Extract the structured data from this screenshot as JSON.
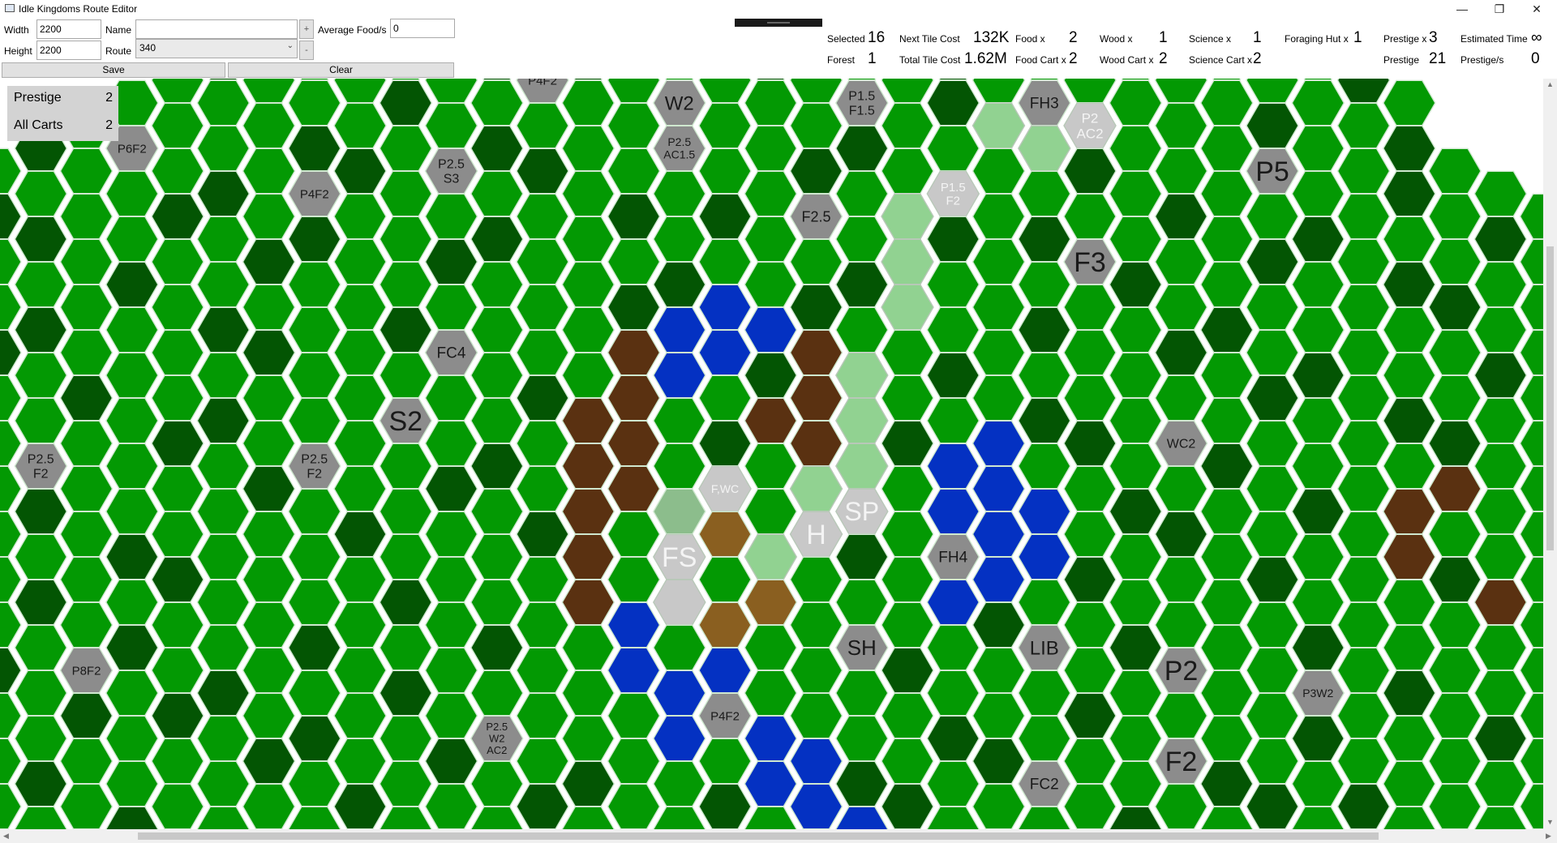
{
  "window": {
    "title": "Idle Kingdoms Route Editor",
    "minimize_glyph": "—",
    "maximize_glyph": "❐",
    "close_glyph": "✕"
  },
  "editor": {
    "width_label": "Width",
    "width_value": "2200",
    "height_label": "Height",
    "height_value": "2200",
    "name_label": "Name",
    "name_value": "",
    "route_label": "Route",
    "route_value": "340",
    "add_glyph": "+",
    "remove_glyph": "-",
    "avg_food_label": "Average Food/s",
    "avg_food_value": "0",
    "save_label": "Save",
    "clear_label": "Clear"
  },
  "stats": {
    "selected_label": "Selected",
    "selected_value": "16",
    "forest_label": "Forest",
    "forest_value": "1",
    "next_tile_cost_label": "Next Tile Cost",
    "next_tile_cost_value": "132K",
    "total_tile_cost_label": "Total Tile Cost",
    "total_tile_cost_value": "1.62M",
    "food_x_label": "Food x",
    "food_x_value": "2",
    "food_cart_x_label": "Food Cart x",
    "food_cart_x_value": "2",
    "wood_x_label": "Wood x",
    "wood_x_value": "1",
    "wood_cart_x_label": "Wood Cart x",
    "wood_cart_x_value": "2",
    "science_x_label": "Science x",
    "science_x_value": "1",
    "science_cart_x_label": "Science Cart x",
    "science_cart_x_value": "2",
    "foraging_hut_x_label": "Foraging Hut x",
    "foraging_hut_x_value": "1",
    "prestige_x_label": "Prestige x",
    "prestige_x_value": "3",
    "prestige_label": "Prestige",
    "prestige_value": "21",
    "estimated_time_label": "Estimated Time",
    "estimated_time_value": "∞",
    "prestige_per_s_label": "Prestige/s",
    "prestige_per_s_value": "0"
  },
  "legend": {
    "prestige_label": "Prestige",
    "prestige_value": "2",
    "all_carts_label": "All Carts",
    "all_carts_value": "2"
  },
  "scroll_arrows": {
    "up": "▲",
    "down": "▼",
    "left": "◀",
    "right": "▶"
  },
  "colors": {
    "grass": "#039903",
    "forest": "#035503",
    "water": "#0431c2",
    "mountain": "#5a3111",
    "dirt": "#8a5f20",
    "special": "#8c8c8c",
    "route": "#91d291",
    "route_special": "#c8c8c8",
    "route_forest": "#8cbd8c",
    "border": "#cfe8cf"
  },
  "map": {
    "forest_tiles": [
      [
        0,
        -1
      ],
      [
        2,
        -1
      ],
      [
        3,
        -1
      ],
      [
        5,
        -1
      ],
      [
        8,
        -1
      ],
      [
        11,
        -1
      ],
      [
        13,
        -1
      ],
      [
        17,
        -1
      ],
      [
        21,
        -1
      ],
      [
        24,
        -1
      ],
      [
        28,
        -1
      ],
      [
        30,
        -1
      ],
      [
        9,
        0
      ],
      [
        12,
        0
      ],
      [
        19,
        0
      ],
      [
        21,
        0
      ],
      [
        30,
        0
      ],
      [
        1,
        1
      ],
      [
        7,
        1
      ],
      [
        11,
        1
      ],
      [
        15,
        1
      ],
      [
        19,
        1
      ],
      [
        22,
        1
      ],
      [
        24,
        1
      ],
      [
        28,
        1
      ],
      [
        31,
        1
      ],
      [
        5,
        2
      ],
      [
        8,
        2
      ],
      [
        12,
        2
      ],
      [
        18,
        2
      ],
      [
        24,
        2
      ],
      [
        31,
        2
      ],
      [
        0,
        3
      ],
      [
        1,
        3
      ],
      [
        4,
        3
      ],
      [
        7,
        3
      ],
      [
        11,
        3
      ],
      [
        14,
        3
      ],
      [
        16,
        3
      ],
      [
        21,
        3
      ],
      [
        23,
        3
      ],
      [
        26,
        3
      ],
      [
        29,
        3
      ],
      [
        33,
        3
      ],
      [
        3,
        4
      ],
      [
        6,
        4
      ],
      [
        10,
        4
      ],
      [
        15,
        4
      ],
      [
        19,
        4
      ],
      [
        25,
        4
      ],
      [
        28,
        4
      ],
      [
        31,
        4
      ],
      [
        1,
        5
      ],
      [
        5,
        5
      ],
      [
        9,
        5
      ],
      [
        14,
        5
      ],
      [
        18,
        5
      ],
      [
        23,
        5
      ],
      [
        27,
        5
      ],
      [
        32,
        5
      ],
      [
        0,
        6
      ],
      [
        6,
        6
      ],
      [
        10,
        6
      ],
      [
        17,
        6
      ],
      [
        21,
        6
      ],
      [
        26,
        6
      ],
      [
        29,
        6
      ],
      [
        33,
        6
      ],
      [
        2,
        7
      ],
      [
        5,
        7
      ],
      [
        9,
        7
      ],
      [
        12,
        7
      ],
      [
        19,
        7
      ],
      [
        23,
        7
      ],
      [
        28,
        7
      ],
      [
        31,
        7
      ],
      [
        4,
        8
      ],
      [
        7,
        8
      ],
      [
        11,
        8
      ],
      [
        14,
        8
      ],
      [
        16,
        8
      ],
      [
        20,
        8
      ],
      [
        24,
        8
      ],
      [
        27,
        8
      ],
      [
        32,
        8
      ],
      [
        1,
        9
      ],
      [
        6,
        9
      ],
      [
        10,
        9
      ],
      [
        13,
        9
      ],
      [
        18,
        9
      ],
      [
        22,
        9
      ],
      [
        25,
        9
      ],
      [
        29,
        9
      ],
      [
        3,
        10
      ],
      [
        8,
        10
      ],
      [
        12,
        10
      ],
      [
        15,
        10
      ],
      [
        19,
        10
      ],
      [
        23,
        10
      ],
      [
        26,
        10
      ],
      [
        31,
        10
      ],
      [
        1,
        11
      ],
      [
        4,
        11
      ],
      [
        9,
        11
      ],
      [
        13,
        11
      ],
      [
        17,
        11
      ],
      [
        21,
        11
      ],
      [
        24,
        11
      ],
      [
        28,
        11
      ],
      [
        32,
        11
      ],
      [
        3,
        12
      ],
      [
        7,
        12
      ],
      [
        11,
        12
      ],
      [
        14,
        12
      ],
      [
        19,
        12
      ],
      [
        22,
        12
      ],
      [
        25,
        12
      ],
      [
        29,
        12
      ],
      [
        0,
        13
      ],
      [
        5,
        13
      ],
      [
        9,
        13
      ],
      [
        16,
        13
      ],
      [
        20,
        13
      ],
      [
        26,
        13
      ],
      [
        31,
        13
      ],
      [
        2,
        14
      ],
      [
        4,
        14
      ],
      [
        7,
        14
      ],
      [
        11,
        14
      ],
      [
        15,
        14
      ],
      [
        21,
        14
      ],
      [
        24,
        14
      ],
      [
        29,
        14
      ],
      [
        33,
        14
      ],
      [
        1,
        15
      ],
      [
        6,
        15
      ],
      [
        10,
        15
      ],
      [
        13,
        15
      ],
      [
        19,
        15
      ],
      [
        22,
        15
      ],
      [
        27,
        15
      ],
      [
        3,
        16
      ],
      [
        8,
        16
      ],
      [
        12,
        16
      ],
      [
        16,
        16
      ],
      [
        20,
        16
      ],
      [
        25,
        16
      ],
      [
        28,
        16
      ],
      [
        30,
        16
      ]
    ],
    "water_tiles": [
      [
        15,
        5
      ],
      [
        16,
        5
      ],
      [
        17,
        5
      ],
      [
        15,
        6
      ],
      [
        16,
        6
      ],
      [
        14,
        13
      ],
      [
        21,
        8
      ],
      [
        22,
        8
      ],
      [
        21,
        9
      ],
      [
        22,
        9
      ],
      [
        23,
        9
      ],
      [
        21,
        10
      ],
      [
        22,
        10
      ],
      [
        23,
        10
      ],
      [
        21,
        11
      ],
      [
        22,
        11
      ],
      [
        14,
        12
      ],
      [
        15,
        13
      ],
      [
        16,
        13
      ],
      [
        15,
        14
      ],
      [
        16,
        14
      ],
      [
        17,
        14
      ],
      [
        17,
        15
      ],
      [
        18,
        15
      ],
      [
        18,
        16
      ],
      [
        19,
        16
      ]
    ],
    "mountain_tiles": [
      [
        14,
        6
      ],
      [
        18,
        6
      ],
      [
        13,
        7
      ],
      [
        14,
        7
      ],
      [
        17,
        7
      ],
      [
        18,
        7
      ],
      [
        13,
        8
      ],
      [
        14,
        8
      ],
      [
        18,
        8
      ],
      [
        13,
        9
      ],
      [
        14,
        9
      ],
      [
        13,
        10
      ],
      [
        13,
        11
      ],
      [
        31,
        9
      ],
      [
        32,
        9
      ],
      [
        31,
        10
      ],
      [
        33,
        11
      ]
    ],
    "dirt_tiles": [
      [
        16,
        10
      ],
      [
        17,
        11
      ],
      [
        16,
        12
      ]
    ],
    "route_tiles": [
      [
        22,
        1
      ],
      [
        23,
        1
      ],
      [
        20,
        3
      ],
      [
        20,
        4
      ],
      [
        20,
        5
      ],
      [
        19,
        6
      ],
      [
        19,
        7
      ],
      [
        19,
        8
      ],
      [
        17,
        10
      ],
      [
        16,
        9
      ],
      [
        18,
        9
      ]
    ],
    "route_forest_tiles": [
      [
        15,
        9
      ]
    ],
    "route_special_tiles": [
      {
        "pos": [
          24,
          1
        ],
        "label": "P2\nAC2",
        "size": 17
      },
      {
        "pos": [
          21,
          2
        ],
        "label": "P1.5\nF2",
        "size": 15
      },
      {
        "pos": [
          16,
          9
        ],
        "label": "F,WC",
        "size": 14
      },
      {
        "pos": [
          19,
          9
        ],
        "label": "SP",
        "size": 32
      },
      {
        "pos": [
          15,
          10
        ],
        "label": "FS",
        "size": 34
      },
      {
        "pos": [
          18,
          10
        ],
        "label": "H",
        "size": 34
      },
      {
        "pos": [
          15,
          11
        ],
        "label": "",
        "size": 14
      }
    ],
    "special_tiles": [
      {
        "pos": [
          15,
          0
        ],
        "label": "W2",
        "size": 24
      },
      {
        "pos": [
          12,
          0
        ],
        "label": "P4F2",
        "size": 15
      },
      {
        "pos": [
          19,
          0
        ],
        "label": "P1.5\nF1.5",
        "size": 16
      },
      {
        "pos": [
          23,
          0
        ],
        "label": "FH3",
        "size": 19
      },
      {
        "pos": [
          3,
          1
        ],
        "label": "P6F2",
        "size": 15
      },
      {
        "pos": [
          15,
          1
        ],
        "label": "P2.5\nAC1.5",
        "size": 14
      },
      {
        "pos": [
          7,
          2
        ],
        "label": "P4F2",
        "size": 15
      },
      {
        "pos": [
          10,
          2
        ],
        "label": "P2.5\nS3",
        "size": 16
      },
      {
        "pos": [
          28,
          2
        ],
        "label": "P5",
        "size": 34
      },
      {
        "pos": [
          18,
          3
        ],
        "label": "F2.5",
        "size": 18
      },
      {
        "pos": [
          24,
          4
        ],
        "label": "F3",
        "size": 34
      },
      {
        "pos": [
          10,
          6
        ],
        "label": "FC4",
        "size": 19
      },
      {
        "pos": [
          9,
          7
        ],
        "label": "S2",
        "size": 34
      },
      {
        "pos": [
          1,
          8
        ],
        "label": "P2.5\nF2",
        "size": 16
      },
      {
        "pos": [
          7,
          8
        ],
        "label": "P2.5\nF2",
        "size": 16
      },
      {
        "pos": [
          26,
          8
        ],
        "label": "WC2",
        "size": 16
      },
      {
        "pos": [
          21,
          10
        ],
        "label": "FH4",
        "size": 19
      },
      {
        "pos": [
          19,
          12
        ],
        "label": "SH",
        "size": 26
      },
      {
        "pos": [
          23,
          12
        ],
        "label": "LIB",
        "size": 24
      },
      {
        "pos": [
          2,
          13
        ],
        "label": "P8F2",
        "size": 15
      },
      {
        "pos": [
          26,
          13
        ],
        "label": "P2",
        "size": 34
      },
      {
        "pos": [
          29,
          13
        ],
        "label": "P3W2",
        "size": 14
      },
      {
        "pos": [
          11,
          14
        ],
        "label": "P2.5\nW2\nAC2",
        "size": 13
      },
      {
        "pos": [
          16,
          14
        ],
        "label": "P4F2",
        "size": 15
      },
      {
        "pos": [
          23,
          15
        ],
        "label": "FC2",
        "size": 19
      },
      {
        "pos": [
          26,
          15
        ],
        "label": "F2",
        "size": 34
      }
    ]
  }
}
